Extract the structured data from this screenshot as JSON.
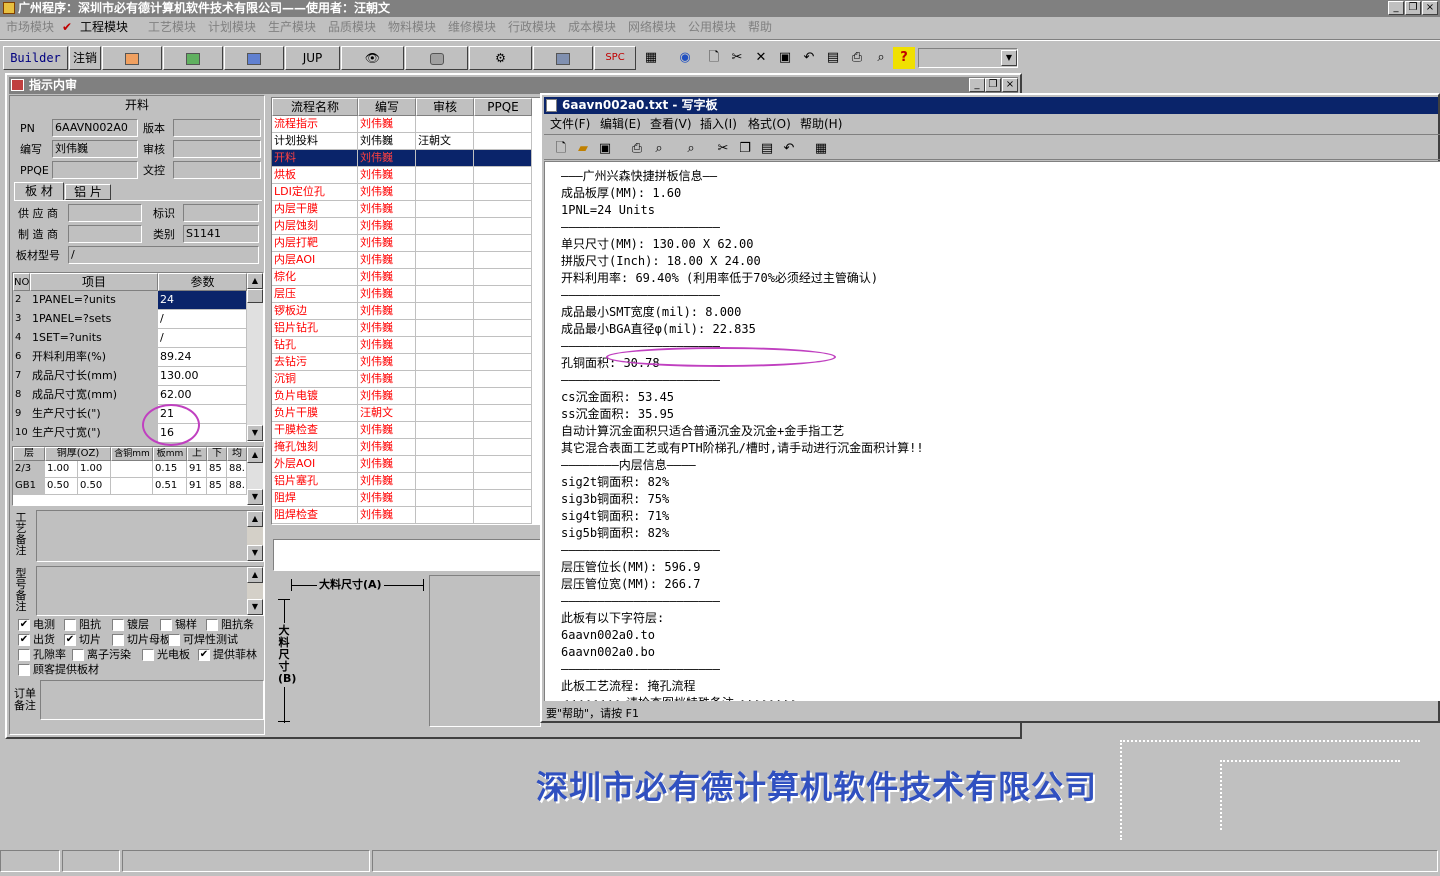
{
  "app": {
    "title": "广州程序：深圳市必有德计算机软件技术有限公司——使用者：汪朝文",
    "menu": [
      "市场模块",
      "工程模块",
      "工艺模块",
      "计划模块",
      "生产模块",
      "品质模块",
      "物料模块",
      "维修模块",
      "行政模块",
      "成本模块",
      "网络模块",
      "公用模块",
      "帮助"
    ],
    "window_buttons": [
      "_",
      "❐",
      "×"
    ]
  },
  "toolbar": {
    "builder": "Builder",
    "logout": "注销",
    "jup": "JUP",
    "spc": "SPC",
    "help": "?"
  },
  "child": {
    "title": "指示内审",
    "section_title": "开料",
    "fields": {
      "pn_label": "PN",
      "pn_value": "6AAVN002A0",
      "author_label": "编写",
      "author_value": "刘伟巍",
      "ppqe_label": "PPQE",
      "ppqe_value": "",
      "version_label": "版本",
      "version_value": "",
      "review_label": "审核",
      "review_value": "",
      "control_label": "文控",
      "control_value": ""
    },
    "tabs": [
      "板 材",
      "铝 片"
    ],
    "material": {
      "supplier_label": "供 应 商",
      "supplier_value": "",
      "mark_label": "标识",
      "mark_value": "",
      "maker_label": "制 造 商",
      "maker_value": "",
      "category_label": "类别",
      "category_value": "S1141",
      "model_label": "板材型号",
      "model_value": "/"
    },
    "param_grid": {
      "headers": [
        "NO",
        "项目",
        "参数"
      ],
      "rows": [
        [
          "2",
          "1PANEL=?units",
          "24"
        ],
        [
          "3",
          "1PANEL=?sets",
          "/"
        ],
        [
          "4",
          "1SET=?units",
          "/"
        ],
        [
          "6",
          "开料利用率(%)",
          "89.24"
        ],
        [
          "7",
          "成品尺寸长(mm)",
          "130.00"
        ],
        [
          "8",
          "成品尺寸宽(mm)",
          "62.00"
        ],
        [
          "9",
          "生产尺寸长(\")",
          "21"
        ],
        [
          "10",
          "生产尺寸宽(\")",
          "16"
        ]
      ]
    },
    "layer_grid": {
      "headers": [
        "层",
        "铜厚(OZ)",
        "含铜mm",
        "板mm",
        "上",
        "下",
        "均"
      ],
      "rows": [
        [
          "2/3",
          "1.00",
          "1.00",
          "0.15",
          "91",
          "85",
          "88."
        ],
        [
          "GB1",
          "0.50",
          "0.50",
          "0.51",
          "91",
          "85",
          "88."
        ]
      ]
    },
    "memo_labels": {
      "craft": "工艺备注",
      "model": "型号备注",
      "order": "订单备注"
    },
    "checkboxes": [
      {
        "label": "电测",
        "checked": true
      },
      {
        "label": "阻抗",
        "checked": false
      },
      {
        "label": "镀层",
        "checked": false
      },
      {
        "label": "锡样",
        "checked": false
      },
      {
        "label": "阻抗条",
        "checked": false
      },
      {
        "label": "出货",
        "checked": true
      },
      {
        "label": "切片",
        "checked": true
      },
      {
        "label": "切片母板",
        "checked": false
      },
      {
        "label": "可焊性测试",
        "checked": false
      },
      {
        "label": "孔隙率",
        "checked": false
      },
      {
        "label": "离子污染",
        "checked": false
      },
      {
        "label": "光电板",
        "checked": false
      },
      {
        "label": "提供菲林",
        "checked": true
      },
      {
        "label": "顾客提供板材",
        "checked": false
      }
    ],
    "flow_grid": {
      "headers": [
        "流程名称",
        "编写",
        "审核",
        "PPQE"
      ],
      "rows": [
        {
          "name": "流程指示",
          "author": "刘伟巍",
          "reviewer": "",
          "ppqe": "",
          "red": true
        },
        {
          "name": "计划投料",
          "author": "刘伟巍",
          "reviewer": "汪朝文",
          "ppqe": "",
          "red": false
        },
        {
          "name": "开料",
          "author": "刘伟巍",
          "reviewer": "",
          "ppqe": "",
          "red": true,
          "selected": true
        },
        {
          "name": "烘板",
          "author": "刘伟巍",
          "reviewer": "",
          "ppqe": "",
          "red": true
        },
        {
          "name": "LDI定位孔",
          "author": "刘伟巍",
          "reviewer": "",
          "ppqe": "",
          "red": true
        },
        {
          "name": "内层干膜",
          "author": "刘伟巍",
          "reviewer": "",
          "ppqe": "",
          "red": true
        },
        {
          "name": "内层蚀刻",
          "author": "刘伟巍",
          "reviewer": "",
          "ppqe": "",
          "red": true
        },
        {
          "name": "内层打靶",
          "author": "刘伟巍",
          "reviewer": "",
          "ppqe": "",
          "red": true
        },
        {
          "name": "内层AOI",
          "author": "刘伟巍",
          "reviewer": "",
          "ppqe": "",
          "red": true
        },
        {
          "name": "棕化",
          "author": "刘伟巍",
          "reviewer": "",
          "ppqe": "",
          "red": true
        },
        {
          "name": "层压",
          "author": "刘伟巍",
          "reviewer": "",
          "ppqe": "",
          "red": true
        },
        {
          "name": "锣板边",
          "author": "刘伟巍",
          "reviewer": "",
          "ppqe": "",
          "red": true
        },
        {
          "name": "铝片钻孔",
          "author": "刘伟巍",
          "reviewer": "",
          "ppqe": "",
          "red": true
        },
        {
          "name": "钻孔",
          "author": "刘伟巍",
          "reviewer": "",
          "ppqe": "",
          "red": true
        },
        {
          "name": "去钻污",
          "author": "刘伟巍",
          "reviewer": "",
          "ppqe": "",
          "red": true
        },
        {
          "name": "沉铜",
          "author": "刘伟巍",
          "reviewer": "",
          "ppqe": "",
          "red": true
        },
        {
          "name": "负片电镀",
          "author": "刘伟巍",
          "reviewer": "",
          "ppqe": "",
          "red": true
        },
        {
          "name": "负片干膜",
          "author": "汪朝文",
          "reviewer": "",
          "ppqe": "",
          "red": true
        },
        {
          "name": "干膜检查",
          "author": "刘伟巍",
          "reviewer": "",
          "ppqe": "",
          "red": true
        },
        {
          "name": "掩孔蚀刻",
          "author": "刘伟巍",
          "reviewer": "",
          "ppqe": "",
          "red": true
        },
        {
          "name": "外层AOI",
          "author": "刘伟巍",
          "reviewer": "",
          "ppqe": "",
          "red": true
        },
        {
          "name": "铝片塞孔",
          "author": "刘伟巍",
          "reviewer": "",
          "ppqe": "",
          "red": true
        },
        {
          "name": "阻焊",
          "author": "刘伟巍",
          "reviewer": "",
          "ppqe": "",
          "red": true
        },
        {
          "name": "阻焊检查",
          "author": "刘伟巍",
          "reviewer": "",
          "ppqe": "",
          "red": true
        }
      ]
    },
    "diagram": {
      "label_a": "大料尺寸(A)",
      "label_b": "大料尺寸(B)"
    }
  },
  "wordpad": {
    "title": "6aavn002a0.txt - 写字板",
    "menu": [
      "文件(F)",
      "编辑(E)",
      "查看(V)",
      "插入(I)",
      "格式(O)",
      "帮助(H)"
    ],
    "lines": [
      "———广州兴森快捷拼板信息——",
      "成品板厚(MM): 1.60",
      "1PNL=24 Units",
      "——————————————————————",
      "单只尺寸(MM): 130.00 X 62.00",
      "拼版尺寸(Inch): 18.00 X 24.00",
      "开料利用率: 69.40% (利用率低于70%必须经过主管确认)",
      "——————————————————————",
      "成品最小SMT宽度(mil): 8.000",
      "成品最小BGA直径φ(mil): 22.835",
      "——————————————————————",
      "孔铜面积: 30.78",
      "——————————————————————",
      "cs沉金面积: 53.45",
      "ss沉金面积: 35.95",
      "自动计算沉金面积只适合普通沉金及沉金+金手指工艺",
      "其它混合表面工艺或有PTH阶梯孔/槽时,请手动进行沉金面积计算!!",
      "————————内层信息————",
      "sig2t铜面积: 82%",
      "sig3b铜面积: 75%",
      "sig4t铜面积: 71%",
      "sig5b铜面积: 82%",
      "——————————————————————",
      "层压管位长(MM): 596.9",
      "层压管位宽(MM): 266.7",
      "——————————————————————",
      "此板有以下字符层:",
      "6aavn002a0.to",
      "6aavn002a0.bo",
      "——————————————————————",
      "此板工艺流程: 掩孔流程",
      "<<<<<<<< 请检查图档特殊备注 >>>>>>>>"
    ],
    "status": "要\"帮助\"，请按 F1"
  },
  "watermark": "深圳市必有德计算机软件技术有限公司",
  "colors": {
    "highlight": "#0a246a",
    "red_text": "#ff0000",
    "annotation": "#c040c0",
    "watermark": "#3050c0"
  }
}
